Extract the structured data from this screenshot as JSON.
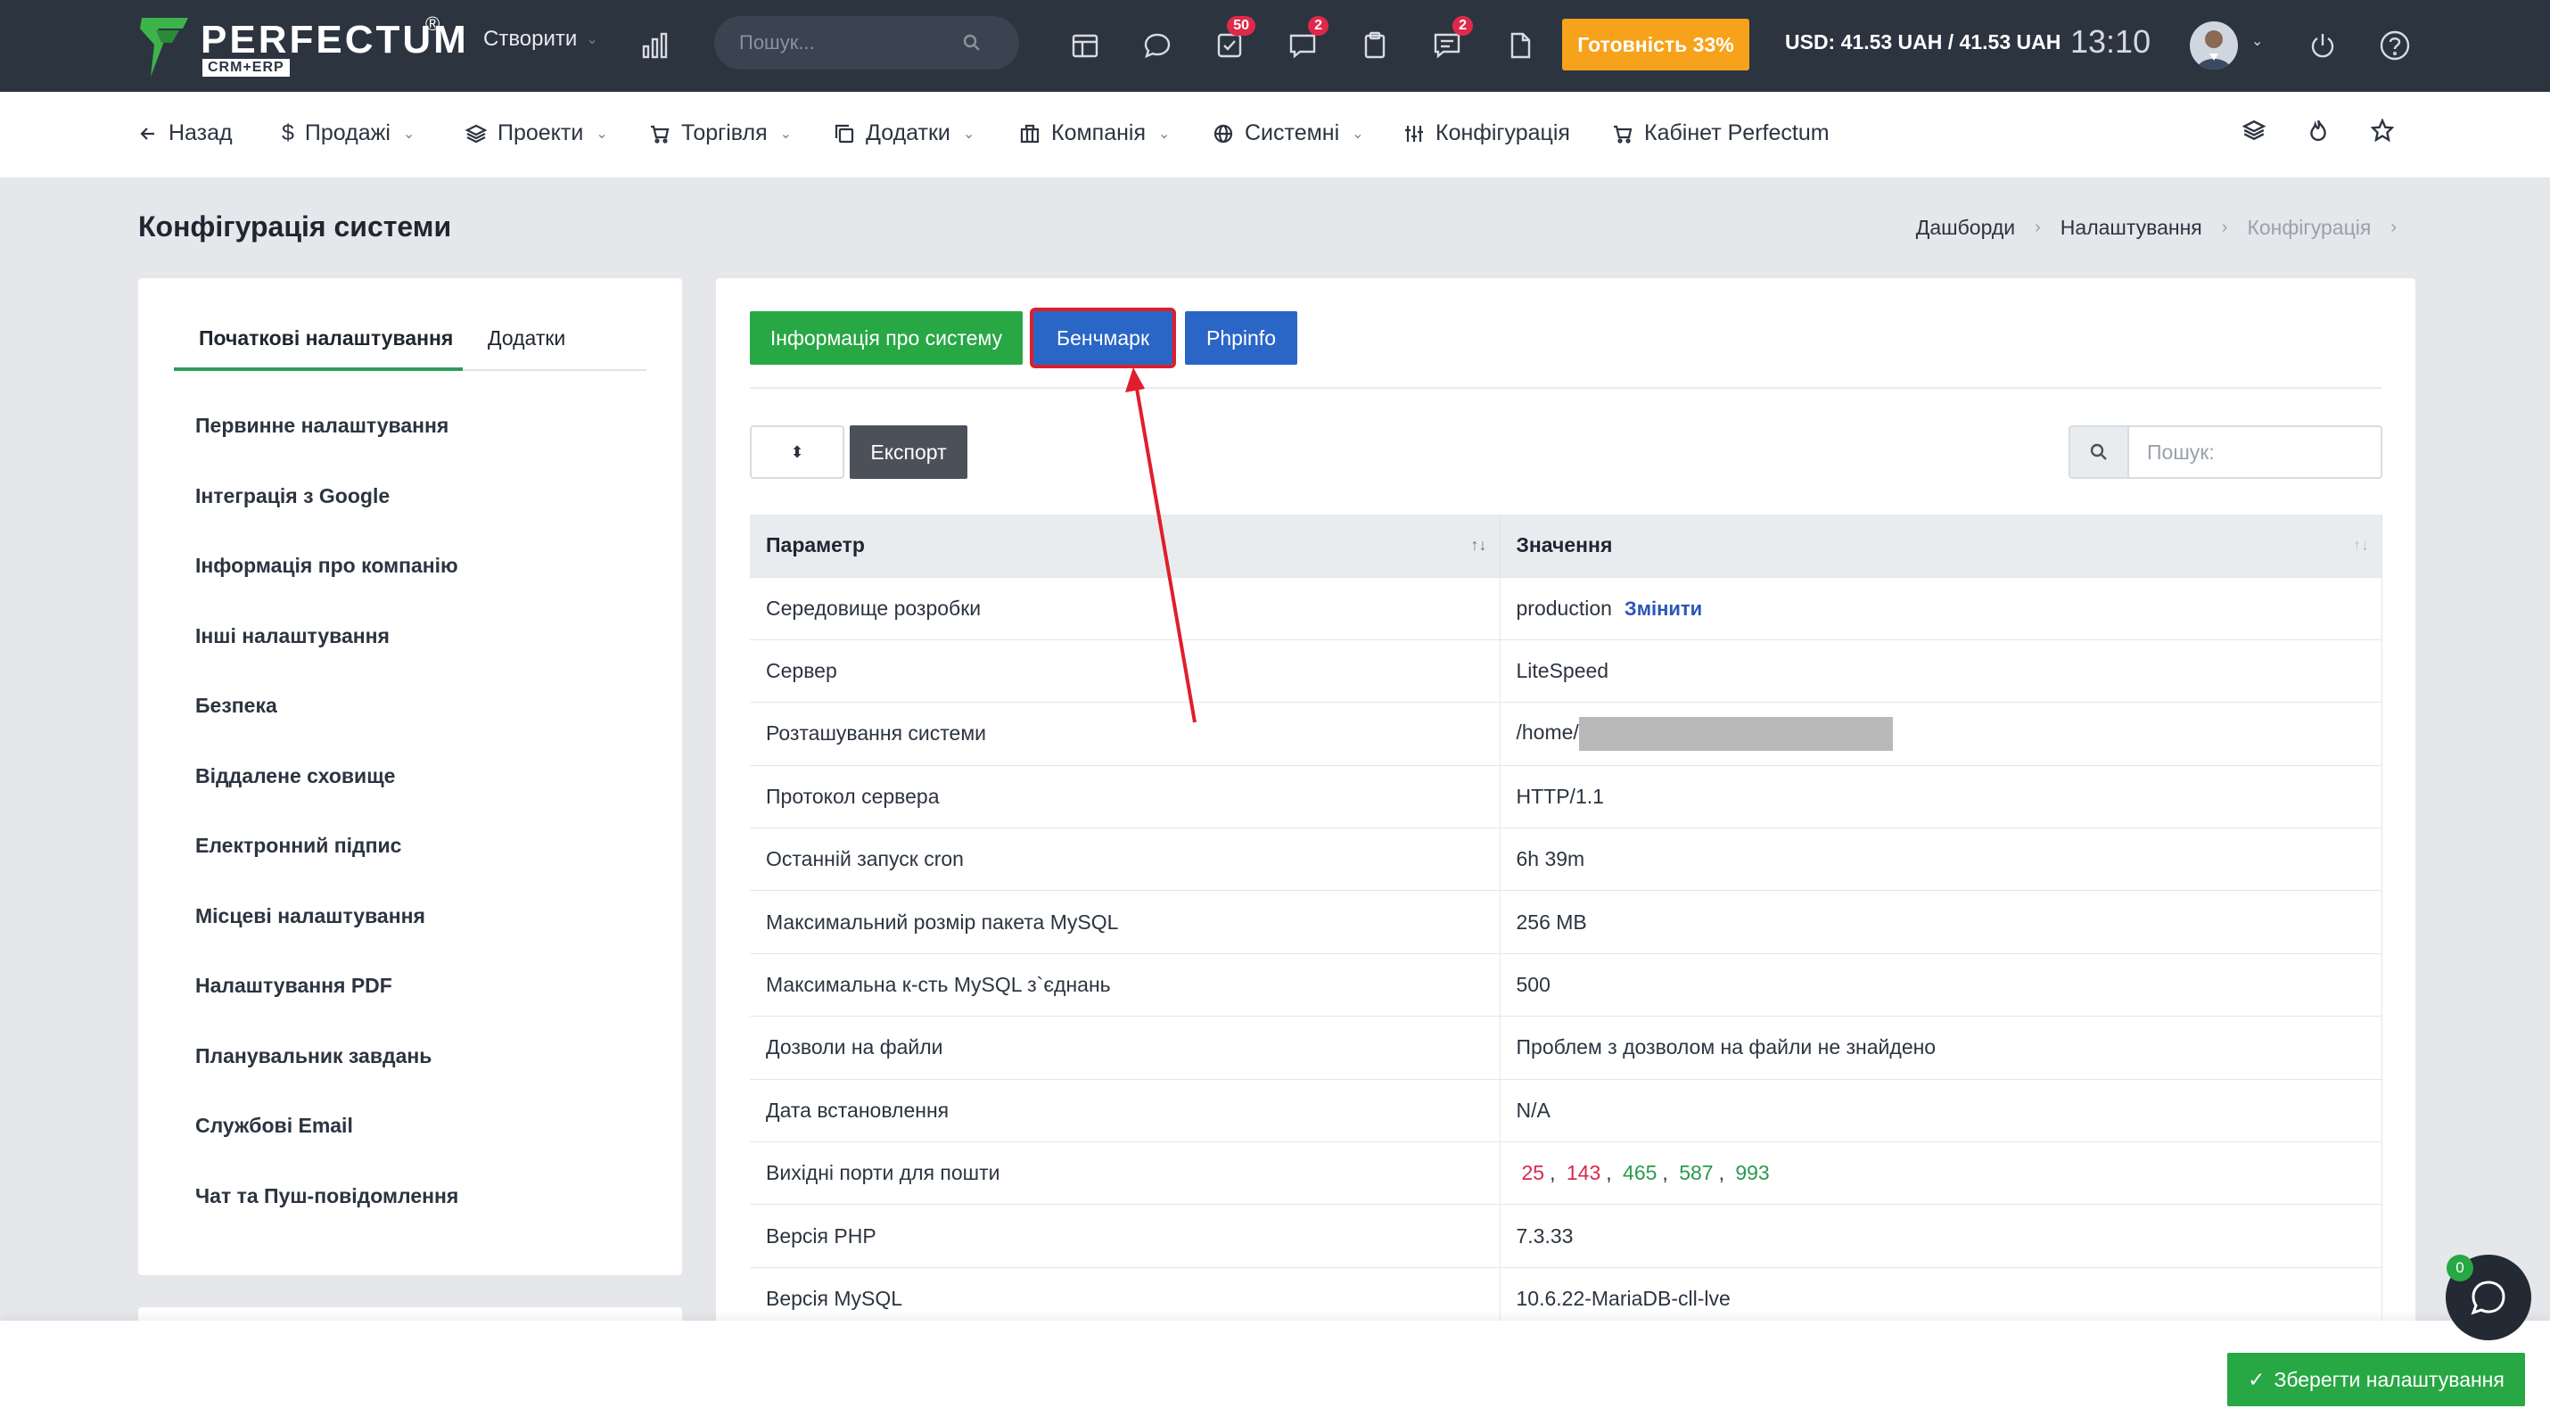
{
  "topbar": {
    "logo_text": "PERFECTUM",
    "logo_sub": "CRM+ERP",
    "logo_reg": "®",
    "create_label": "Створити",
    "search_placeholder": "Пошук...",
    "tasks_badge": "50",
    "messages_badge": "2",
    "comments_badge": "2",
    "readiness_label": "Готовність 33%",
    "currency": "USD: 41.53 UAH / 41.53 UAH",
    "time": "13:10"
  },
  "nav": {
    "back": "Назад",
    "sales": "Продажі",
    "projects": "Проекти",
    "trade": "Торгівля",
    "addons": "Додатки",
    "company": "Компанія",
    "system": "Системні",
    "config": "Конфігурація",
    "cabinet": "Кабінет Perfectum"
  },
  "page": {
    "title": "Конфігурація системи",
    "breadcrumb": [
      "Дашборди",
      "Налаштування",
      "Конфігурація"
    ]
  },
  "left": {
    "tabs": [
      "Початкові налаштування",
      "Додатки"
    ],
    "items": [
      "Первинне налаштування",
      "Інтеграція з Google",
      "Інформація про компанію",
      "Інші налаштування",
      "Безпека",
      "Віддалене сховище",
      "Електронний підпис",
      "Місцеві налаштування",
      "Налаштування PDF",
      "Планувальник завдань",
      "Службові Email",
      "Чат та Пуш-повідомлення"
    ]
  },
  "main": {
    "btn_sysinfo": "Інформація про систему",
    "btn_benchmark": "Бенчмарк",
    "btn_phpinfo": "Phpinfo",
    "btn_export": "Експорт",
    "search_placeholder": "Пошук:",
    "columns": [
      "Параметр",
      "Значення"
    ],
    "change_link": "Змінити",
    "rows": [
      {
        "param": "Середовище розробки",
        "value": "production"
      },
      {
        "param": "Сервер",
        "value": "LiteSpeed"
      },
      {
        "param": "Розташування системи",
        "value": "/home/"
      },
      {
        "param": "Протокол сервера",
        "value": "HTTP/1.1"
      },
      {
        "param": "Останній запуск cron",
        "value": "6h 39m"
      },
      {
        "param": "Максимальний розмір пакета MySQL",
        "value": "256 MB"
      },
      {
        "param": "Максимальна к-сть MySQL з`єднань",
        "value": "500"
      },
      {
        "param": "Дозволи на файли",
        "value": "Проблем з дозволом на файли не знайдено"
      },
      {
        "param": "Дата встановлення",
        "value": "N/A"
      },
      {
        "param": "Вихідні порти для пошти",
        "value": ""
      },
      {
        "param": "Версія PHP",
        "value": "7.3.33"
      },
      {
        "param": "Версія MySQL",
        "value": "10.6.22-MariaDB-cll-lve"
      }
    ],
    "ports": [
      {
        "port": "25",
        "status": "closed"
      },
      {
        "port": "143",
        "status": "closed"
      },
      {
        "port": "465",
        "status": "open"
      },
      {
        "port": "587",
        "status": "open"
      },
      {
        "port": "993",
        "status": "open"
      }
    ]
  },
  "footer": {
    "save_label": "Зберегти налаштування",
    "chat_badge": "0"
  },
  "colors": {
    "topbar": "#2c3440",
    "accent_green": "#28a745",
    "accent_blue": "#2a66c6",
    "highlight_red": "#e01e2b",
    "readiness": "#f7a21b"
  }
}
